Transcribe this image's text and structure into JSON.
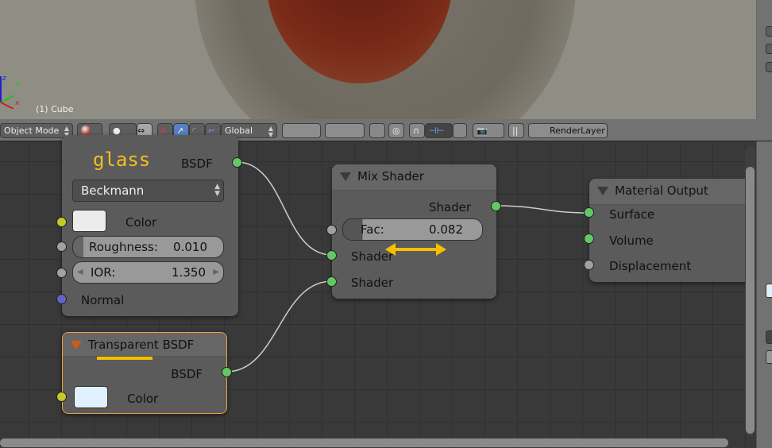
{
  "viewport": {
    "object_label": "(1) Cube",
    "axes": [
      "z",
      "y",
      "x"
    ]
  },
  "header": {
    "mode": "Object Mode",
    "orientation": "Global",
    "render_layer": "RenderLayer"
  },
  "nodes": {
    "glass": {
      "title": "glass",
      "output": "BSDF",
      "distribution": "Beckmann",
      "color_label": "Color",
      "roughness_label": "Roughness:",
      "roughness_value": "0.010",
      "ior_label": "IOR:",
      "ior_value": "1.350",
      "normal_label": "Normal"
    },
    "mix": {
      "title": "Mix Shader",
      "output": "Shader",
      "fac_label": "Fac:",
      "fac_value": "0.082",
      "fac_fraction": 0.082,
      "input1": "Shader",
      "input2": "Shader"
    },
    "output": {
      "title": "Material Output",
      "surface": "Surface",
      "volume": "Volume",
      "displacement": "Displacement"
    },
    "transparent": {
      "title": "Transparent BSDF",
      "output": "BSDF",
      "color_label": "Color"
    }
  },
  "colors": {
    "annotation": "#f5c000",
    "socket_shader": "#63c763",
    "socket_color": "#c7c729",
    "socket_value": "#a1a1a1",
    "socket_vector": "#6363c7",
    "selected_border": "#f0a040"
  }
}
